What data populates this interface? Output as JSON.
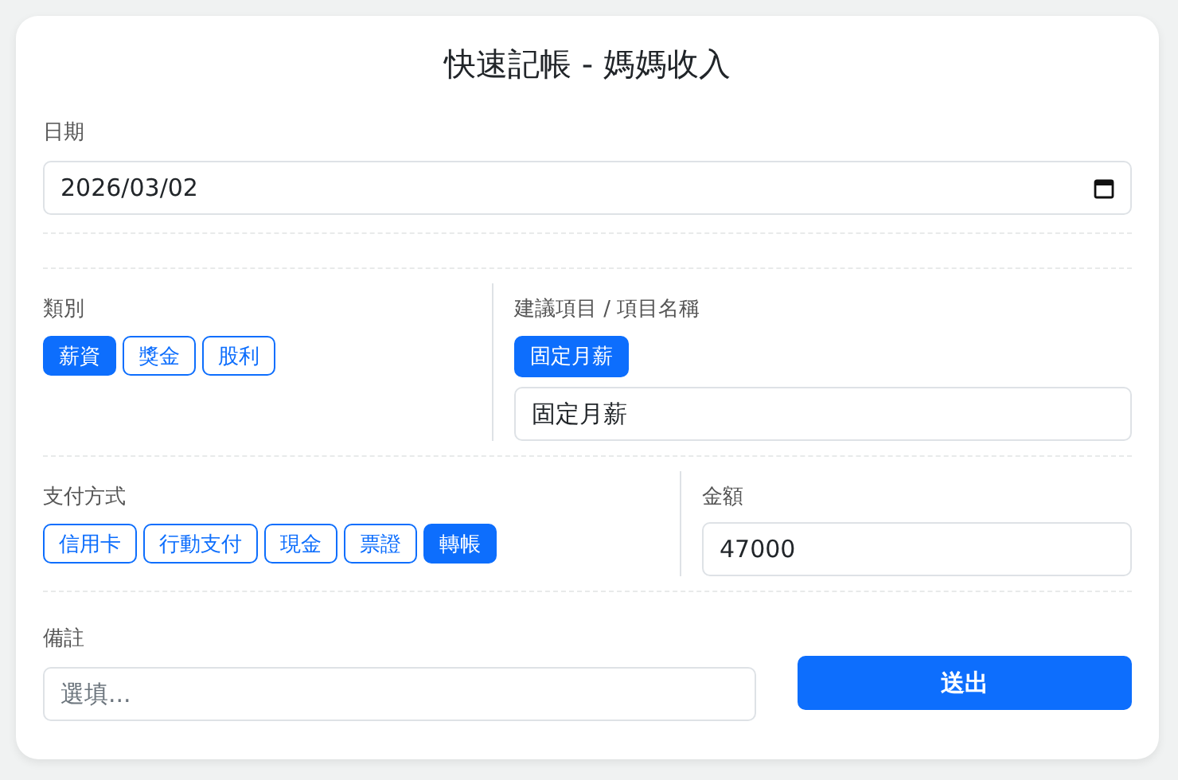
{
  "title": "快速記帳 - 媽媽收入",
  "date": {
    "label": "日期",
    "value": "2026/03/02"
  },
  "category": {
    "label": "類別",
    "options": [
      {
        "label": "薪資",
        "selected": true
      },
      {
        "label": "獎金",
        "selected": false
      },
      {
        "label": "股利",
        "selected": false
      }
    ]
  },
  "item": {
    "label": "建議項目 / 項目名稱",
    "suggestions": [
      {
        "label": "固定月薪",
        "selected": true
      }
    ],
    "value": "固定月薪"
  },
  "payment": {
    "label": "支付方式",
    "options": [
      {
        "label": "信用卡",
        "selected": false
      },
      {
        "label": "行動支付",
        "selected": false
      },
      {
        "label": "現金",
        "selected": false
      },
      {
        "label": "票證",
        "selected": false
      },
      {
        "label": "轉帳",
        "selected": true
      }
    ]
  },
  "amount": {
    "label": "金額",
    "value": "47000"
  },
  "note": {
    "label": "備註",
    "placeholder": "選填..."
  },
  "submit": "送出"
}
